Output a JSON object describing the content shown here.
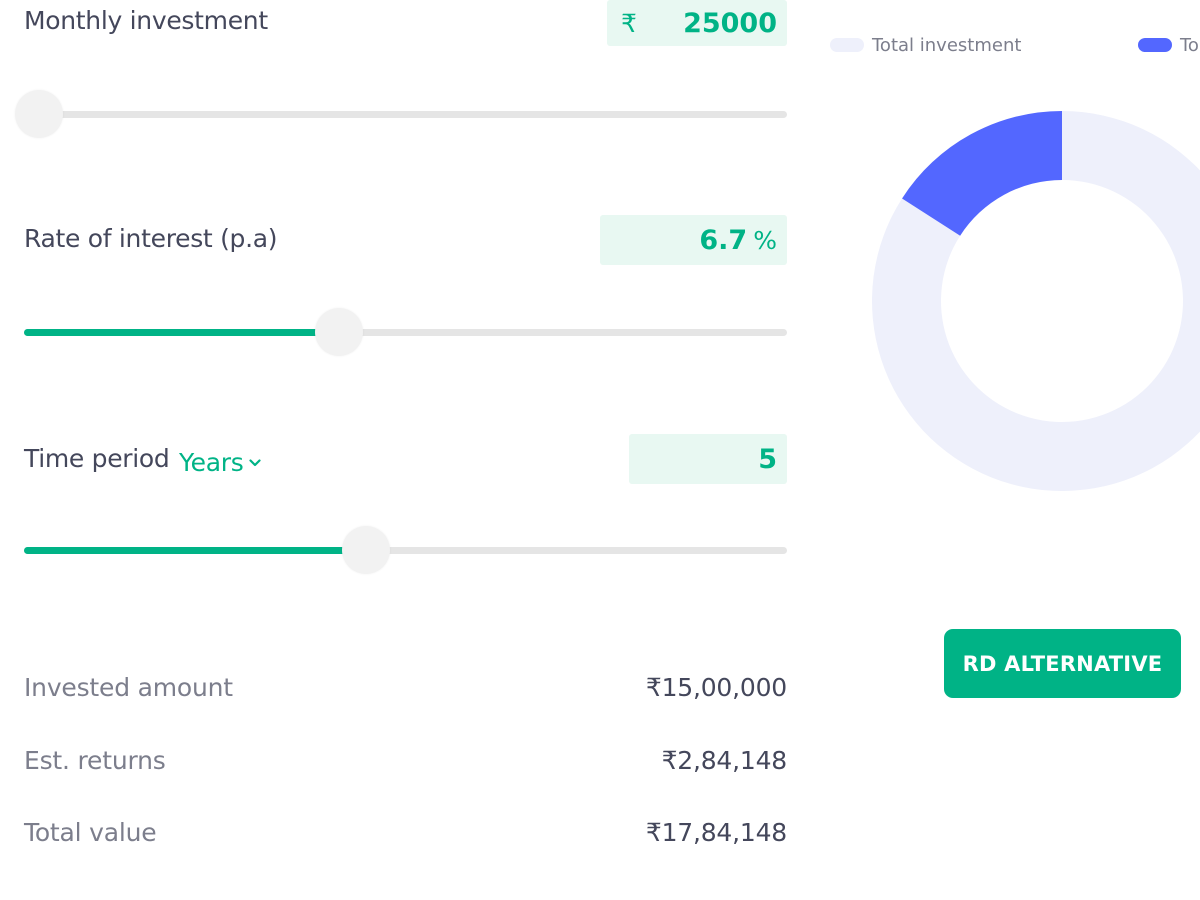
{
  "inputs": {
    "monthly_investment": {
      "label": "Monthly investment",
      "prefix": "₹",
      "value": "25000",
      "slider_fraction": 0.02
    },
    "rate_of_interest": {
      "label": "Rate of interest (p.a)",
      "value": "6.7",
      "suffix": "%",
      "slider_fraction": 0.413
    },
    "time_period": {
      "label": "Time period",
      "unit": "Years",
      "value": "5",
      "slider_fraction": 0.448
    }
  },
  "results": {
    "invested_amount": {
      "label": "Invested amount",
      "value": "₹15,00,000"
    },
    "est_returns": {
      "label": "Est. returns",
      "value": "₹2,84,148"
    },
    "total_value": {
      "label": "Total value",
      "value": "₹17,84,148"
    }
  },
  "legend": {
    "total_investment": "Total investment",
    "total_returns": "To"
  },
  "colors": {
    "accent": "#00b386",
    "accent_light": "#e8f8f2",
    "investment_segment": "#eef0fb",
    "returns_segment": "#5367ff"
  },
  "chart_data": {
    "type": "pie",
    "style": "donut",
    "categories": [
      "Total investment",
      "Total returns"
    ],
    "values": [
      1500000,
      284148
    ]
  },
  "cta": {
    "label": "RD ALTERNATIVE"
  }
}
